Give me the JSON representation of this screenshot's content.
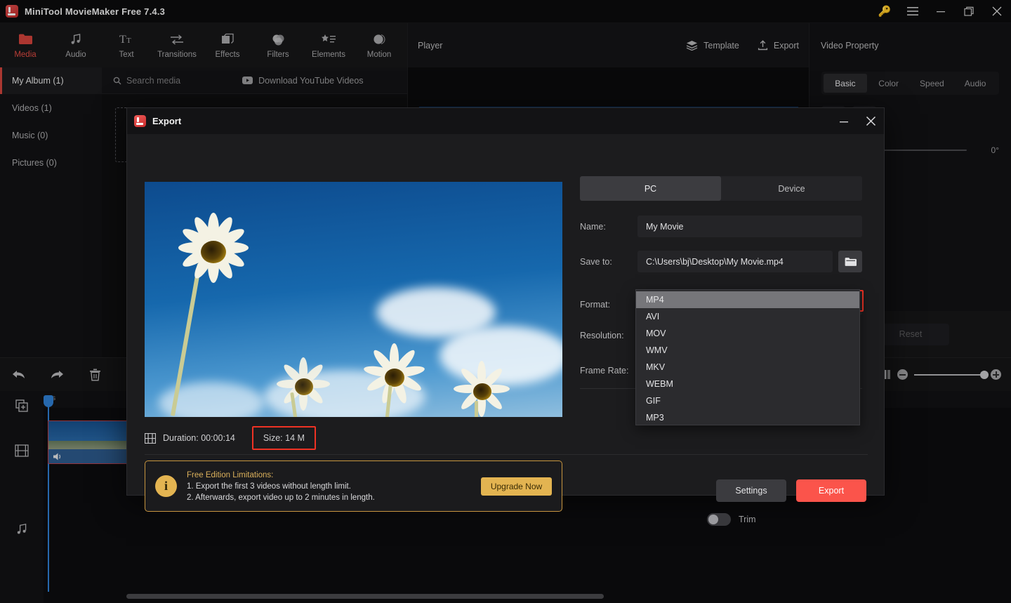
{
  "titlebar": {
    "app_title": "MiniTool MovieMaker Free 7.4.3",
    "logo_name": "minitool-logo",
    "buttons": [
      {
        "name": "license-key-button",
        "glyph": "key"
      },
      {
        "name": "main-menu-button",
        "glyph": "hamburger"
      },
      {
        "name": "minimize-button",
        "glyph": "minimize"
      },
      {
        "name": "maximize-button",
        "glyph": "maximize"
      },
      {
        "name": "close-button",
        "glyph": "close"
      }
    ]
  },
  "toolstrip": {
    "tabs": [
      {
        "label": "Media",
        "icon": "folder-icon",
        "active": true
      },
      {
        "label": "Audio",
        "icon": "music-note-icon",
        "active": false
      },
      {
        "label": "Text",
        "icon": "text-icon",
        "active": false
      },
      {
        "label": "Transitions",
        "icon": "transitions-icon",
        "active": false
      },
      {
        "label": "Effects",
        "icon": "effects-icon",
        "active": false
      },
      {
        "label": "Filters",
        "icon": "filters-icon",
        "active": false
      },
      {
        "label": "Elements",
        "icon": "elements-icon",
        "active": false
      },
      {
        "label": "Motion",
        "icon": "motion-icon",
        "active": false
      }
    ]
  },
  "media_panel": {
    "album_tab": "My Album (1)",
    "search_placeholder": "Search media",
    "download_youtube": "Download YouTube Videos",
    "nav": [
      {
        "label": "Videos (1)"
      },
      {
        "label": "Music (0)"
      },
      {
        "label": "Pictures (0)"
      }
    ]
  },
  "player": {
    "label": "Player",
    "template_label": "Template",
    "export_label": "Export"
  },
  "property_panel": {
    "title": "Video Property",
    "tabs": [
      {
        "label": "Basic",
        "active": true
      },
      {
        "label": "Color",
        "active": false
      },
      {
        "label": "Speed",
        "active": false
      },
      {
        "label": "Audio",
        "active": false
      }
    ],
    "rotation_value": "0°",
    "reset_label": "Reset"
  },
  "timeline": {
    "ruler_start": "0s",
    "tools": [
      {
        "name": "undo-button",
        "icon": "undo-icon"
      },
      {
        "name": "redo-button",
        "icon": "redo-icon"
      },
      {
        "name": "delete-button",
        "icon": "trash-icon"
      }
    ]
  },
  "export_dialog": {
    "title": "Export",
    "logo_name": "minitool-logo",
    "minimize_label": "—",
    "close_label": "×",
    "destination_tabs": [
      {
        "label": "PC",
        "active": true
      },
      {
        "label": "Device",
        "active": false
      }
    ],
    "fields": {
      "name_label": "Name:",
      "name_value": "My Movie",
      "save_to_label": "Save to:",
      "save_to_value": "C:\\Users\\bj\\Desktop\\My Movie.mp4",
      "format_label": "Format:",
      "format_value": "MP4",
      "resolution_label": "Resolution:",
      "frame_rate_label": "Frame Rate:"
    },
    "format_options": [
      {
        "label": "MP4",
        "selected": true
      },
      {
        "label": "AVI",
        "selected": false
      },
      {
        "label": "MOV",
        "selected": false
      },
      {
        "label": "WMV",
        "selected": false
      },
      {
        "label": "MKV",
        "selected": false
      },
      {
        "label": "WEBM",
        "selected": false
      },
      {
        "label": "GIF",
        "selected": false
      },
      {
        "label": "MP3",
        "selected": false
      }
    ],
    "trim_label": "Trim",
    "meta": {
      "duration": "Duration:  00:00:14",
      "size": "Size:  14 M"
    },
    "notice": {
      "heading": "Free Edition Limitations:",
      "line1": "1. Export the first 3 videos without length limit.",
      "line2": "2. Afterwards, export video up to 2 minutes in length.",
      "upgrade_label": "Upgrade Now"
    },
    "settings_label": "Settings",
    "export_label": "Export"
  },
  "colors": {
    "accent_red": "#e14b42",
    "export_red": "#fb544b",
    "highlight_red": "#ef3224",
    "gold": "#e3b451",
    "playhead_blue": "#2f7fd4"
  }
}
